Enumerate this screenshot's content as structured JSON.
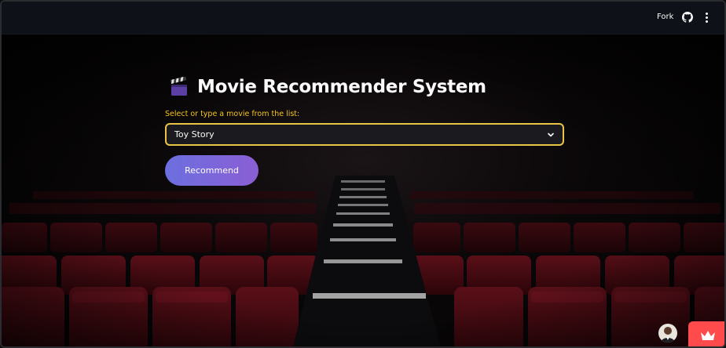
{
  "header": {
    "fork_label": "Fork",
    "github_icon": "github-icon",
    "menu_icon": "kebab-menu-icon"
  },
  "main": {
    "title_icon": "clapperboard-icon",
    "title": "Movie Recommender System",
    "select_label": "Select or type a movie from the list:",
    "selected_movie": "Toy Story",
    "recommend_label": "Recommend"
  },
  "colors": {
    "label": "#f5c518",
    "select_border": "#e8c547",
    "button_gradient_start": "#6c6fe0",
    "button_gradient_end": "#8a5fd4",
    "crown_badge": "#ff4b4b",
    "header_bg": "#0e1117"
  },
  "widgets": {
    "avatar_icon": "user-avatar",
    "badge_icon": "crown-icon"
  }
}
